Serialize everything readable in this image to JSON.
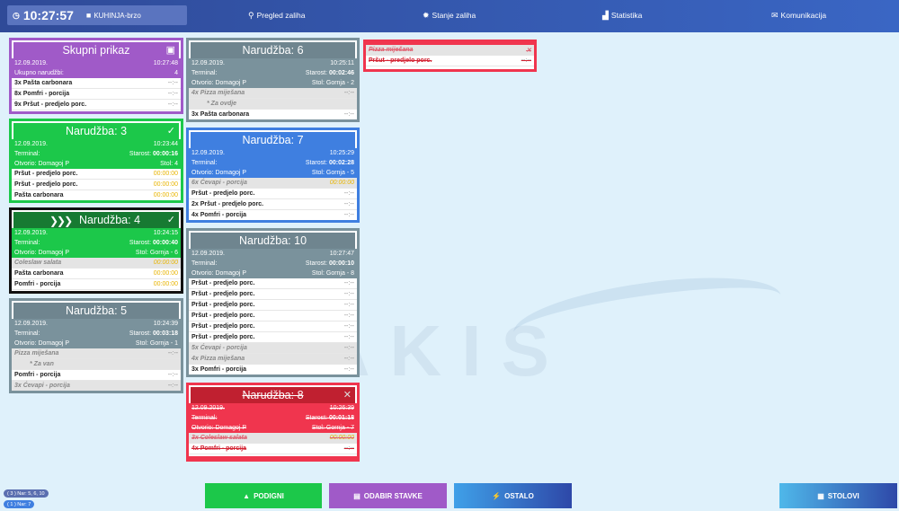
{
  "topbar": {
    "time": "10:27:57",
    "kitchen": "KUHINJA-brzo",
    "nav": [
      "Pregled zaliha",
      "Stanje zaliha",
      "Statistika",
      "Komunikacija"
    ]
  },
  "watermark": "FIMAKIS",
  "summary": {
    "title": "Skupni prikaz",
    "date": "12.09.2019.",
    "time": "10:27:48",
    "count_label": "Ukupno narudžbi:",
    "count": "4",
    "items": [
      {
        "q": "3x",
        "name": "Pašta carbonara",
        "t": "--:--"
      },
      {
        "q": "8x",
        "name": "Pomfri - porcija",
        "t": "--:--"
      },
      {
        "q": "9x",
        "name": "Pršut - predjelo porc.",
        "t": "--:--"
      }
    ]
  },
  "orders": {
    "o3": {
      "title": "Narudžba: 3",
      "date": "12.09.2019.",
      "time": "10:23:44",
      "terminal": "Terminal:",
      "age_label": "Starost:",
      "age": "00:00:16",
      "opened": "Otvorio: Domagoj P",
      "table": "Stol: 4",
      "items": [
        {
          "name": "Pršut - predjelo porc.",
          "t": "00:00:00"
        },
        {
          "name": "Pršut - predjelo porc.",
          "t": "00:00:00"
        },
        {
          "name": "Pašta carbonara",
          "t": "00:00:00"
        }
      ]
    },
    "o4": {
      "title": "Narudžba: 4",
      "date": "12.09.2019.",
      "time": "10:24:15",
      "terminal": "Terminal:",
      "age_label": "Starost:",
      "age": "00:00:40",
      "opened": "Otvorio: Domagoj P",
      "table": "Stol: Gornja - 6",
      "items": [
        {
          "name": "Coleslaw salata",
          "t": "00:00:00"
        },
        {
          "name": "Pašta carbonara",
          "t": "00:00:00"
        },
        {
          "name": "Pomfri - porcija",
          "t": "00:00:00"
        }
      ]
    },
    "o5": {
      "title": "Narudžba: 5",
      "date": "12.09.2019.",
      "time": "10:24:39",
      "terminal": "Terminal:",
      "age_label": "Starost:",
      "age": "00:03:18",
      "opened": "Otvorio: Domagoj P",
      "table": "Stol: Gornja - 1",
      "items": [
        {
          "name": "Pizza miješana",
          "t": "--:--"
        },
        {
          "name": "* Za van",
          "t": ""
        },
        {
          "name": "Pomfri - porcija",
          "t": "--:--"
        },
        {
          "name": "3x  Ćevapi - porcija",
          "t": "--:--"
        }
      ]
    },
    "o6": {
      "title": "Narudžba: 6",
      "date": "12.09.2019.",
      "time": "10:25:11",
      "terminal": "Terminal:",
      "age_label": "Starost:",
      "age": "00:02:46",
      "opened": "Otvorio: Domagoj P",
      "table": "Stol: Gornja - 2",
      "items": [
        {
          "name": "4x  Pizza miješana",
          "t": "--:--"
        },
        {
          "name": "* Za ovdje",
          "t": ""
        },
        {
          "name": "3x  Pašta carbonara",
          "t": "--:--"
        }
      ]
    },
    "o7": {
      "title": "Narudžba: 7",
      "date": "12.09.2019.",
      "time": "10:25:29",
      "terminal": "Terminal:",
      "age_label": "Starost:",
      "age": "00:02:28",
      "opened": "Otvorio: Domagoj P",
      "table": "Stol: Gornja - 5",
      "items": [
        {
          "name": "6x  Ćevapi - porcija",
          "t": "00:00:00"
        },
        {
          "name": "Pršut - predjelo porc.",
          "t": "--:--"
        },
        {
          "name": "2x  Pršut - predjelo porc.",
          "t": "--:--"
        },
        {
          "name": "4x  Pomfri - porcija",
          "t": "--:--"
        }
      ]
    },
    "o10": {
      "title": "Narudžba: 10",
      "date": "12.09.2019.",
      "time": "10:27:47",
      "terminal": "Terminal:",
      "age_label": "Starost:",
      "age": "00:00:10",
      "opened": "Otvorio: Domagoj P",
      "table": "Stol: Gornja - 8",
      "items": [
        {
          "name": "Pršut - predjelo porc.",
          "t": "--:--"
        },
        {
          "name": "Pršut - predjelo porc.",
          "t": "--:--"
        },
        {
          "name": "Pršut - predjelo porc.",
          "t": "--:--"
        },
        {
          "name": "Pršut - predjelo porc.",
          "t": "--:--"
        },
        {
          "name": "Pršut - predjelo porc.",
          "t": "--:--"
        },
        {
          "name": "Pršut - predjelo porc.",
          "t": "--:--"
        },
        {
          "name": "5x  Ćevapi - porcija",
          "t": "--:--"
        },
        {
          "name": "4x  Pizza miješana",
          "t": "--:--"
        },
        {
          "name": "3x  Pomfri - porcija",
          "t": "--:--"
        }
      ]
    },
    "o8": {
      "title": "Narudžba: 8",
      "date": "12.09.2019.",
      "time": "10:26:39",
      "terminal": "Terminal:",
      "age_label": "Starost:",
      "age": "00:01:18",
      "opened": "Otvorio: Domagoj P",
      "table": "Stol: Gornja - 7",
      "items": [
        {
          "name": "3x  Coleslaw salata",
          "t": "00:00:00"
        },
        {
          "name": "4x  Pomfri - porcija",
          "t": "--:--"
        }
      ]
    },
    "o6cont": {
      "items": [
        {
          "name": "Pizza miješana",
          "t": ""
        },
        {
          "name": "Pršut - predjelo porc.",
          "t": "--:--"
        }
      ]
    }
  },
  "bottom": {
    "podigni": "PODIGNI",
    "odabir": "ODABIR STAVKE",
    "ostalo": "OSTALO",
    "stolovi": "STOLOVI"
  },
  "badges": [
    "( 3 ) Nar: 5, 6, 10",
    "( 1 ) Nar: 7"
  ]
}
